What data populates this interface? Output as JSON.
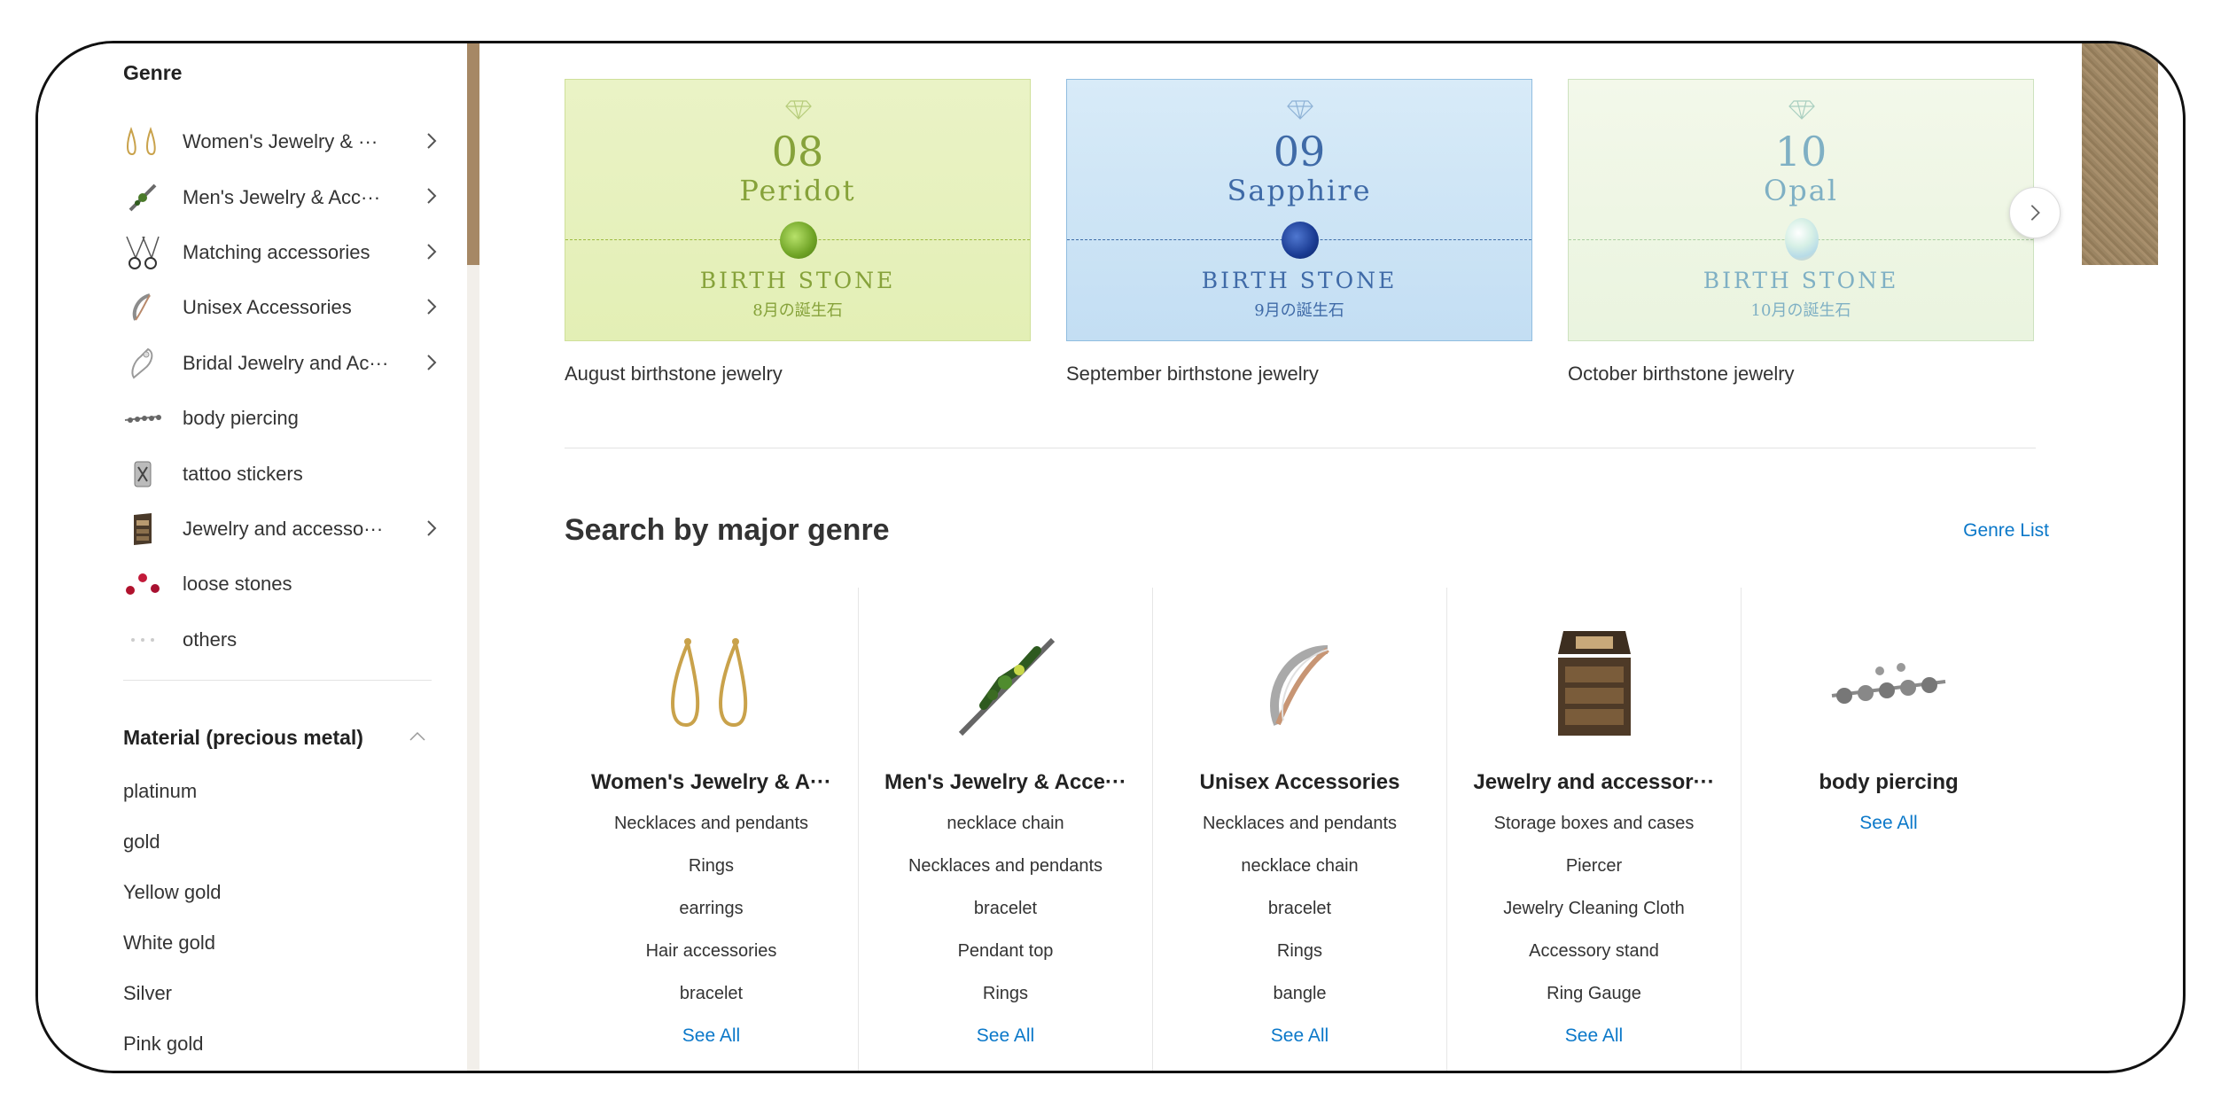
{
  "sidebar": {
    "genre_title": "Genre",
    "genres": [
      {
        "label": "Women's Jewelry & ···",
        "icon": "earrings-icon",
        "chevron": true
      },
      {
        "label": "Men's Jewelry & Acc···",
        "icon": "brooch-icon",
        "chevron": true
      },
      {
        "label": "Matching accessories",
        "icon": "pair-rings-icon",
        "chevron": true
      },
      {
        "label": "Unisex Accessories",
        "icon": "cuff-icon",
        "chevron": true
      },
      {
        "label": "Bridal Jewelry and Ac···",
        "icon": "bridal-icon",
        "chevron": true
      },
      {
        "label": "body piercing",
        "icon": "piercing-icon",
        "chevron": false
      },
      {
        "label": "tattoo stickers",
        "icon": "tattoo-icon",
        "chevron": false
      },
      {
        "label": "Jewelry and accesso···",
        "icon": "jewelry-box-icon",
        "chevron": true
      },
      {
        "label": "loose stones",
        "icon": "loose-stones-icon",
        "chevron": false
      },
      {
        "label": "others",
        "icon": "dots-icon",
        "chevron": false
      }
    ],
    "material_title": "Material (precious metal)",
    "materials": [
      "platinum",
      "gold",
      "Yellow gold",
      "White gold",
      "Silver",
      "Pink gold"
    ]
  },
  "banners": [
    {
      "number": "08",
      "name": "Peridot",
      "birthstone": "BIRTH STONE",
      "jp": "8月の誕生石",
      "caption": "August birthstone jewelry"
    },
    {
      "number": "09",
      "name": "Sapphire",
      "birthstone": "BIRTH STONE",
      "jp": "9月の誕生石",
      "caption": "September birthstone jewelry"
    },
    {
      "number": "10",
      "name": "Opal",
      "birthstone": "BIRTH STONE",
      "jp": "10月の誕生石",
      "caption": "October birthstone jewelry"
    }
  ],
  "section": {
    "title": "Search by major genre",
    "genre_list_link": "Genre List"
  },
  "categories": [
    {
      "title": "Women's Jewelry & A···",
      "subs": [
        "Necklaces and pendants",
        "Rings",
        "earrings",
        "Hair accessories",
        "bracelet"
      ],
      "see_all": "See All"
    },
    {
      "title": "Men's Jewelry & Acce···",
      "subs": [
        "necklace chain",
        "Necklaces and pendants",
        "bracelet",
        "Pendant top",
        "Rings"
      ],
      "see_all": "See All"
    },
    {
      "title": "Unisex Accessories",
      "subs": [
        "Necklaces and pendants",
        "necklace chain",
        "bracelet",
        "Rings",
        "bangle"
      ],
      "see_all": "See All"
    },
    {
      "title": "Jewelry and accessor···",
      "subs": [
        "Storage boxes and cases",
        "Piercer",
        "Jewelry Cleaning Cloth",
        "Accessory stand",
        "Ring Gauge"
      ],
      "see_all": "See All"
    },
    {
      "title": "body piercing",
      "subs": [],
      "see_all": "See All"
    }
  ],
  "colors": {
    "link": "#0b78c9",
    "scrollbar_thumb": "#a68865",
    "peridot": "#86a23a",
    "sapphire": "#3f6aa7",
    "opal": "#7fb0c4"
  }
}
